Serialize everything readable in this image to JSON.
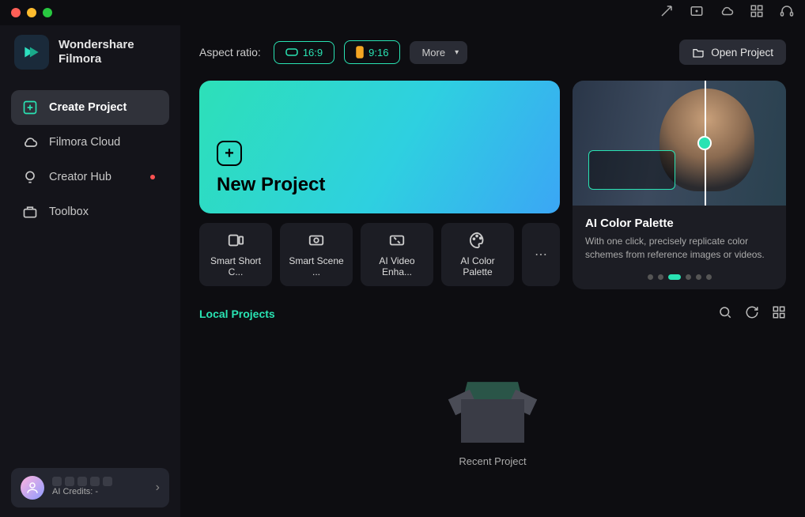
{
  "brand": {
    "line1": "Wondershare",
    "line2": "Filmora"
  },
  "sidebar": {
    "items": [
      {
        "label": "Create Project"
      },
      {
        "label": "Filmora Cloud"
      },
      {
        "label": "Creator Hub"
      },
      {
        "label": "Toolbox"
      }
    ]
  },
  "user": {
    "credits_label": "AI Credits: -"
  },
  "aspect": {
    "label": "Aspect ratio:",
    "opt1": "16:9",
    "opt2": "9:16",
    "more": "More"
  },
  "open_project": "Open Project",
  "new_project": "New Project",
  "tools": [
    {
      "label": "Smart Short C..."
    },
    {
      "label": "Smart Scene ..."
    },
    {
      "label": "AI Video Enha..."
    },
    {
      "label": "AI Color Palette"
    }
  ],
  "feature": {
    "title": "AI Color Palette",
    "desc": "With one click, precisely replicate color schemes from reference images or videos."
  },
  "local_projects": "Local Projects",
  "recent_project": "Recent Project"
}
